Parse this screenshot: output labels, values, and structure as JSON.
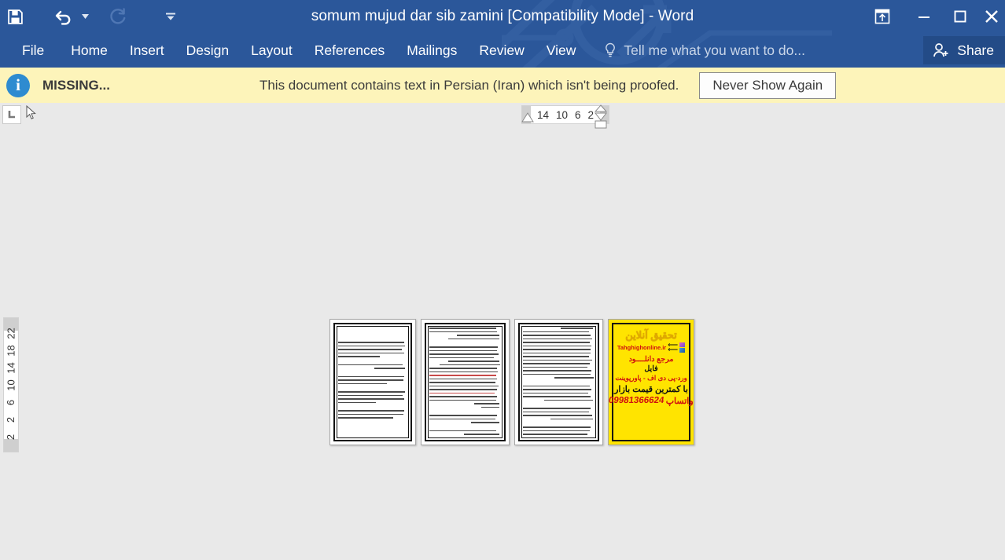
{
  "window": {
    "title": "somum mujud dar sib zamini [Compatibility Mode] - Word",
    "accent_color": "#2b579a",
    "share_bg": "#234b87"
  },
  "quick_access": {
    "items": [
      {
        "name": "save-icon",
        "label": "Save",
        "enabled": "true"
      },
      {
        "name": "undo-icon",
        "label": "Undo",
        "enabled": "true"
      },
      {
        "name": "undo-dropdown-icon",
        "label": "Undo options",
        "enabled": "true"
      },
      {
        "name": "redo-icon",
        "label": "Redo",
        "enabled": "false"
      },
      {
        "name": "customize-qat-icon",
        "label": "Customize Quick Access Toolbar",
        "enabled": "true"
      }
    ]
  },
  "window_controls": {
    "ribbon_display_label": "Ribbon Display Options",
    "minimize_label": "Minimize",
    "restore_label": "Restore Down",
    "close_label": "Close"
  },
  "ribbon": {
    "tabs": [
      {
        "label": "File"
      },
      {
        "label": "Home"
      },
      {
        "label": "Insert"
      },
      {
        "label": "Design"
      },
      {
        "label": "Layout"
      },
      {
        "label": "References"
      },
      {
        "label": "Mailings"
      },
      {
        "label": "Review"
      },
      {
        "label": "View"
      }
    ],
    "tell_me": "Tell me what you want to do...",
    "share_label": "Share"
  },
  "message_bar": {
    "icon": "info-icon",
    "label": "MISSING...",
    "text": "This document contains text in Persian (Iran) which isn't being proofed.",
    "button_label": "Never Show Again",
    "background": "#fdf4ba"
  },
  "rulers": {
    "tab_selector": "L",
    "horizontal_ticks": "14 10 6  2",
    "horizontal_tick_values": [
      "14",
      "10",
      "6",
      "2"
    ],
    "vertical_tick_values": [
      "2",
      "2",
      "6",
      "10",
      "14",
      "18",
      "22"
    ]
  },
  "document": {
    "view": "multiple-pages",
    "page_count": 4,
    "pages": [
      {
        "name": "page-1",
        "kind": "text",
        "language": "fa-IR"
      },
      {
        "name": "page-2",
        "kind": "text",
        "language": "fa-IR"
      },
      {
        "name": "page-3",
        "kind": "text",
        "language": "fa-IR"
      },
      {
        "name": "page-4",
        "kind": "advertisement",
        "language": "fa-IR"
      }
    ],
    "ad_page": {
      "background": "#ffe400",
      "logo_text": "تحقیق آنلاین",
      "url": "Tahghighonline.ir",
      "line1": "مرجع دانلــــود",
      "line2": "فایل",
      "line3": "ورد-پی دی اف - پاورپوینت",
      "line4": "با کمترین قیمت بازار",
      "whatsapp_label": "واتساپ",
      "phone": "09981366624"
    }
  }
}
